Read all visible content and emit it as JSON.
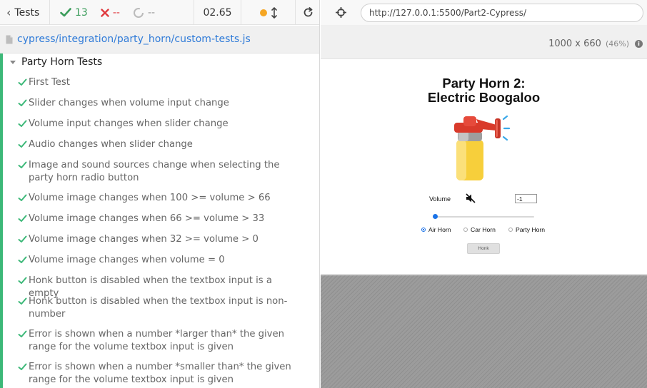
{
  "reporter": {
    "tests_label": "Tests",
    "passed": "13",
    "failed": "--",
    "pending": "--",
    "duration": "02.65",
    "spec_path": "cypress/integration/party_horn/custom-tests.js",
    "suite_title": "Party Horn Tests",
    "tests": [
      {
        "label": "First Test"
      },
      {
        "label": "Slider changes when volume input change"
      },
      {
        "label": "Volume input changes when slider change"
      },
      {
        "label": "Audio changes when slider change"
      },
      {
        "label": "Image and sound sources change when selecting the party horn radio button"
      },
      {
        "label": "Volume image changes when 100 >= volume > 66"
      },
      {
        "label": "Volume image changes when 66 >= volume > 33"
      },
      {
        "label": "Volume image changes when 32 >= volume > 0"
      },
      {
        "label": "Volume image changes when volume = 0"
      },
      {
        "label": "Honk button is disabled when the textbox input is a empty"
      },
      {
        "label": "Honk button is disabled when the textbox input is non-number"
      },
      {
        "label": "Error is shown when a number *larger than* the given range for the volume textbox input is given"
      },
      {
        "label": "Error is shown when a number *smaller than* the given range for the volume textbox input is given"
      }
    ]
  },
  "browser": {
    "url": "http://127.0.0.1:5500/Part2-Cypress/",
    "viewport_size": "1000 x 660",
    "viewport_scale": "(46%)"
  },
  "app": {
    "title_line1": "Party Horn 2:",
    "title_line2": "Electric Boogaloo",
    "volume_label": "Volume",
    "volume_value": "-1",
    "slider_value_fraction": 0,
    "radio_options": [
      {
        "label": "Air Horn",
        "selected": true
      },
      {
        "label": "Car Horn",
        "selected": false
      },
      {
        "label": "Party Horn",
        "selected": false
      }
    ],
    "honk_label": "Honk"
  },
  "icons": {
    "back": "chevron-left-icon",
    "pass": "check-icon",
    "fail": "x-icon",
    "pending": "circle-notch-icon",
    "reload": "reload-icon",
    "file": "file-icon",
    "crosshair": "crosshair-icon",
    "info": "info-icon",
    "mute": "volume-mute-icon"
  },
  "colors": {
    "pass": "#3a9c5a",
    "fail": "#e0393e",
    "link": "#2f7bd8",
    "running_dot": "#f5a623"
  }
}
